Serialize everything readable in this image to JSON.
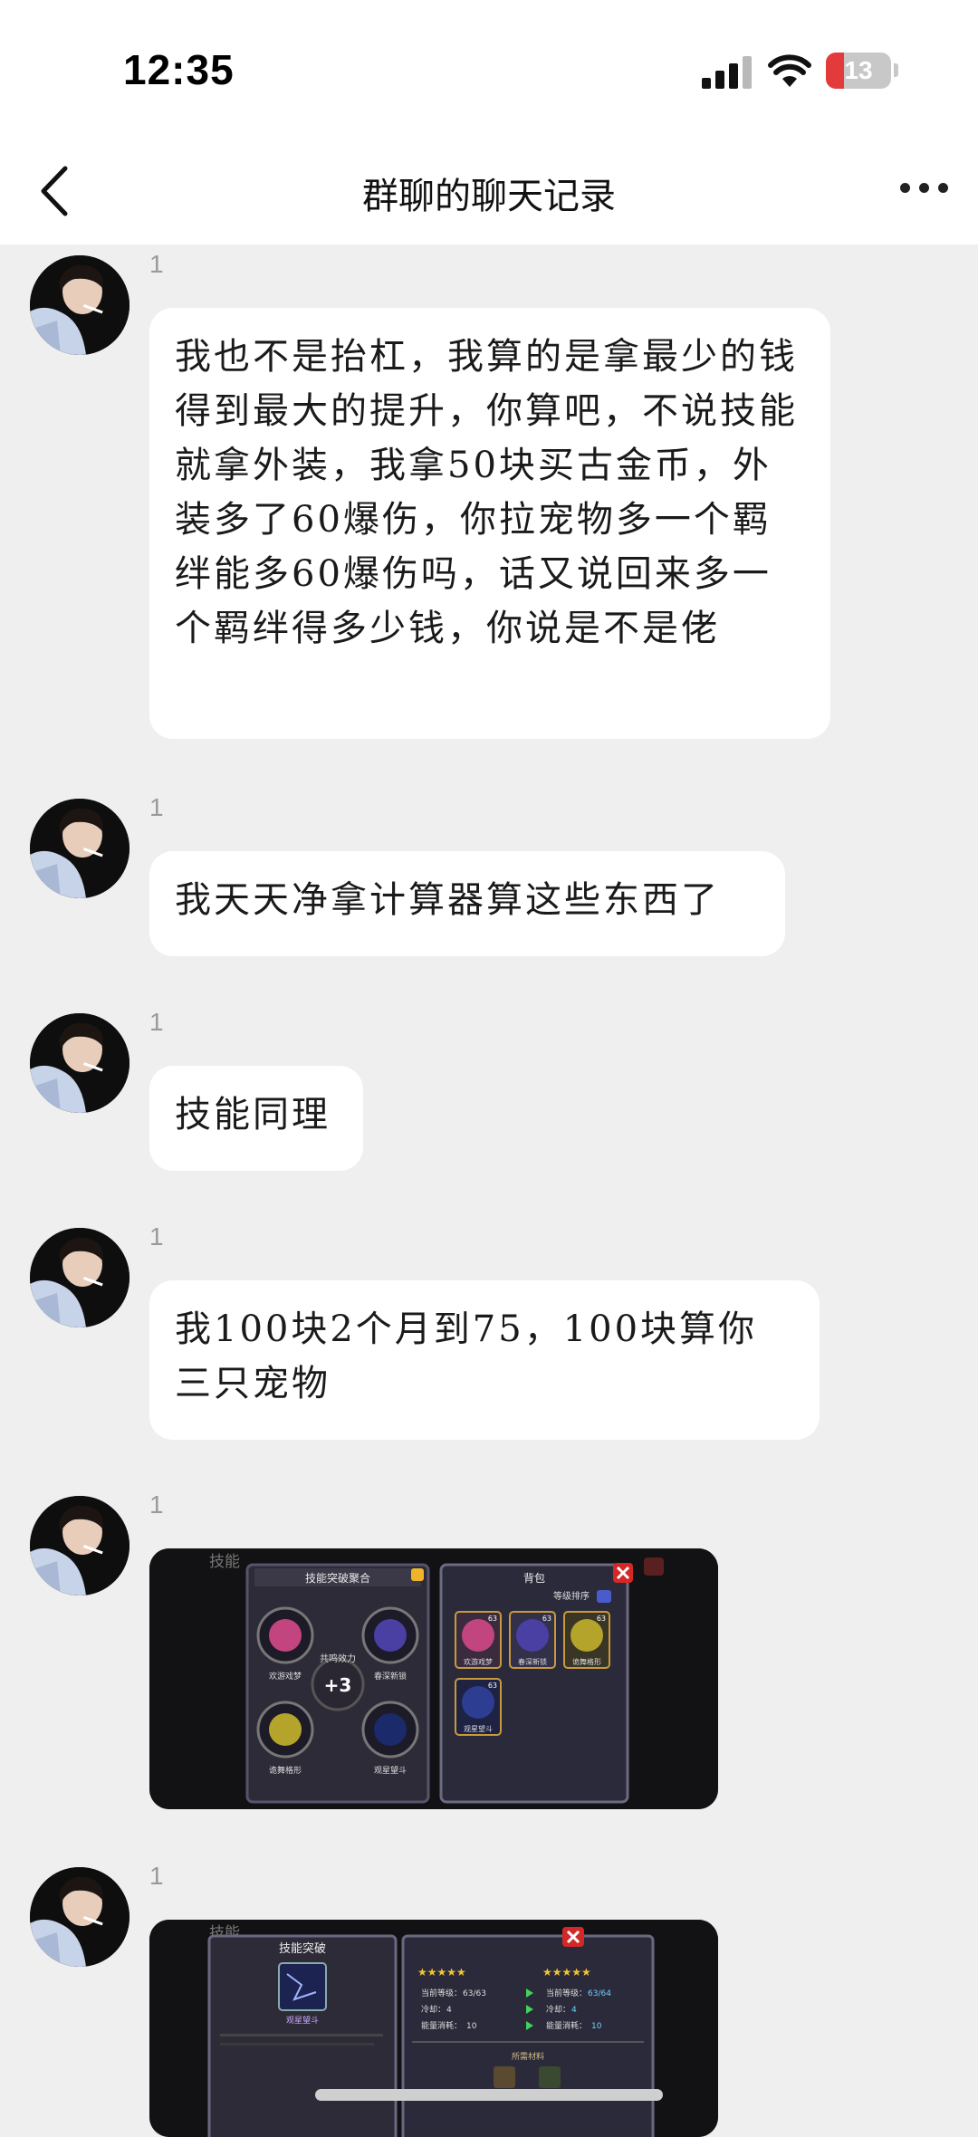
{
  "status_bar": {
    "time": "12:35",
    "battery": "13"
  },
  "nav": {
    "title": "群聊的聊天记录"
  },
  "messages": [
    {
      "sender": "1",
      "text": "我也不是抬杠，我算的是拿最少的钱得到最大的提升，你算吧，不说技能就拿外装，我拿50块买古金币，外装多了60爆伤，你拉宠物多一个羁绊能多60爆伤吗，话又说回来多一个羁绊得多少钱，你说是不是佬"
    },
    {
      "sender": "1",
      "text": "我天天净拿计算器算这些东西了"
    },
    {
      "sender": "1",
      "text": "技能同理"
    },
    {
      "sender": "1",
      "text": "我100块2个月到75，100块算你三只宠物"
    },
    {
      "sender": "1",
      "image": {
        "bg_label": "技能",
        "left_panel": {
          "title": "技能突破聚合",
          "center_label": "共鸣效力",
          "center_value": "+3",
          "skills": [
            "欢游戏梦",
            "春深新锁",
            "诡舞格形",
            "观星望斗"
          ]
        },
        "right_panel": {
          "title": "背包",
          "sort_label": "等级排序",
          "items": [
            {
              "name": "欢游戏梦",
              "level": "63"
            },
            {
              "name": "春深新锁",
              "level": "63"
            },
            {
              "name": "诡舞格形",
              "level": "63"
            },
            {
              "name": "观星望斗",
              "level": "63"
            }
          ]
        }
      }
    },
    {
      "sender": "1",
      "image": {
        "bg_label": "技能",
        "left_panel": {
          "title": "技能突破",
          "skill": "观星望斗"
        },
        "right_panel": {
          "before": {
            "level_label": "当前等级：",
            "level": "63/63",
            "cd_label": "冷却：",
            "cd": "4",
            "energy_label": "能量消耗：",
            "energy": "10"
          },
          "after": {
            "level_label": "当前等级：",
            "level": "63/64",
            "cd_label": "冷却：",
            "cd": "4",
            "energy_label": "能量消耗：",
            "energy": "10"
          },
          "materials_label": "所需材料"
        }
      }
    }
  ],
  "colors": {
    "bubble": "#ffffff",
    "background": "#efefef",
    "sender": "#9a9a9a",
    "battery_low": "#e33b3b"
  },
  "icons": [
    "back-chevron-icon",
    "more-dots-icon",
    "signal-icon",
    "wifi-icon",
    "battery-icon"
  ]
}
